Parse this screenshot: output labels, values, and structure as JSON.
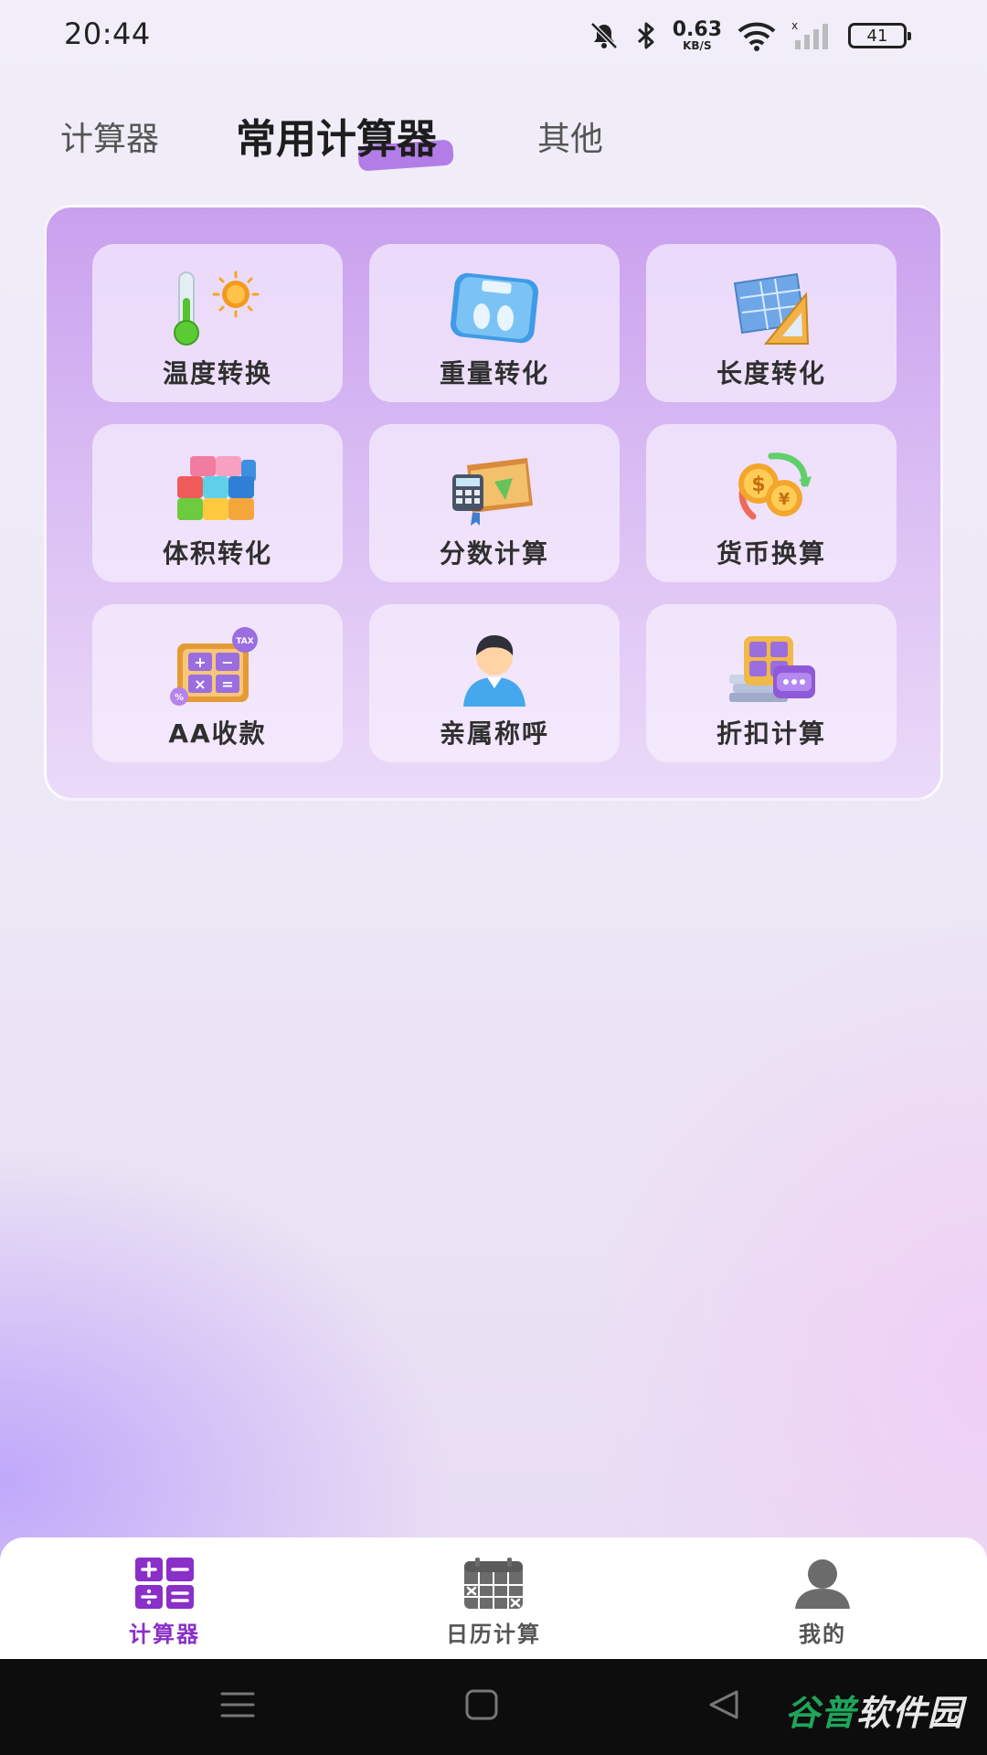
{
  "status_bar": {
    "time": "20:44",
    "net_speed_value": "0.63",
    "net_speed_unit": "KB/S",
    "battery": "41",
    "icons": [
      "bell-muted-icon",
      "bluetooth-icon",
      "wifi-icon",
      "signal-icon",
      "battery-icon"
    ]
  },
  "top_tabs": [
    {
      "label": "计算器",
      "active": false
    },
    {
      "label": "常用计算器",
      "active": true
    },
    {
      "label": "其他",
      "active": false
    }
  ],
  "tools": [
    {
      "label": "温度转换",
      "icon": "thermometer-sun-icon"
    },
    {
      "label": "重量转化",
      "icon": "scale-icon"
    },
    {
      "label": "长度转化",
      "icon": "blueprint-ruler-icon"
    },
    {
      "label": "体积转化",
      "icon": "cube-icon"
    },
    {
      "label": "分数计算",
      "icon": "books-calculator-icon"
    },
    {
      "label": "货币换算",
      "icon": "coins-exchange-icon"
    },
    {
      "label": "AA收款",
      "icon": "tax-calculator-icon"
    },
    {
      "label": "亲属称呼",
      "icon": "person-icon"
    },
    {
      "label": "折扣计算",
      "icon": "discount-calculator-icon"
    }
  ],
  "bottom_nav": [
    {
      "label": "计算器",
      "icon": "calculator-grid-icon",
      "active": true
    },
    {
      "label": "日历计算",
      "icon": "calendar-icon",
      "active": false
    },
    {
      "label": "我的",
      "icon": "user-icon",
      "active": false
    }
  ],
  "colors": {
    "accent": "#8a2fc7",
    "panel_top": "#c9a0ee",
    "tab_highlight": "#b27de6"
  },
  "watermark": {
    "part1": "谷普",
    "part2": "软件园"
  }
}
